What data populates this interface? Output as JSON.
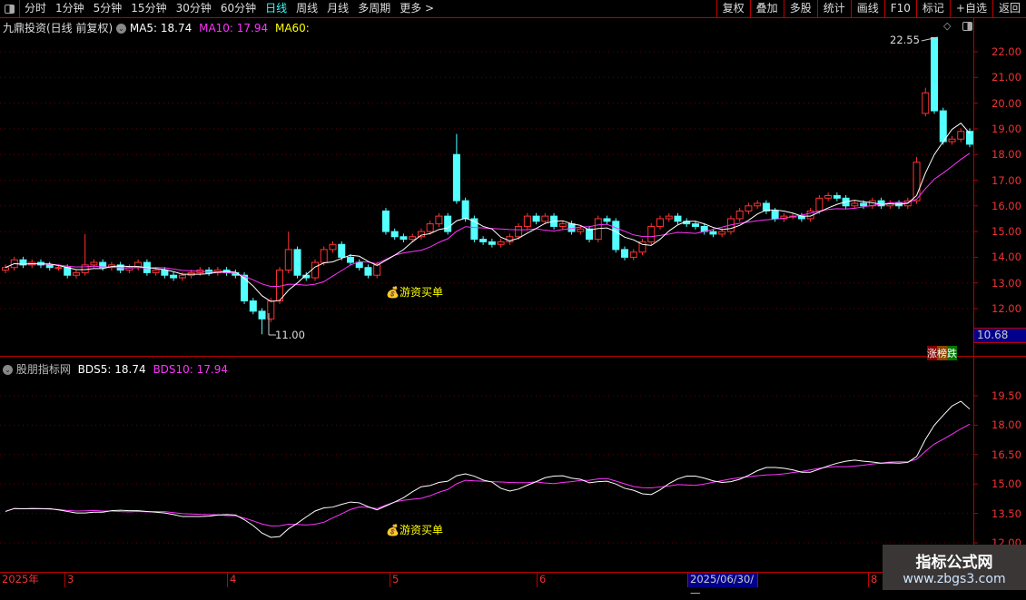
{
  "toolbar": {
    "periods": [
      "分时",
      "1分钟",
      "5分钟",
      "15分钟",
      "30分钟",
      "60分钟",
      "日线",
      "周线",
      "月线",
      "多周期",
      "更多 >"
    ],
    "active": "日线",
    "right": [
      "复权",
      "叠加",
      "多股",
      "统计",
      "画线",
      "F10",
      "标记",
      "+自选",
      "返回"
    ]
  },
  "main": {
    "title": "九鼎投资(日线 前复权)",
    "ma5": "MA5: 18.74",
    "ma10": "MA10: 17.94",
    "ma60": "MA60:",
    "high_label": "22.55",
    "low_label": "11.00",
    "signal": "游资买单",
    "current_price": "10.68",
    "badge": [
      "涨",
      "榜",
      "跌"
    ],
    "ticks": [
      "22.00",
      "21.00",
      "20.00",
      "19.00",
      "18.00",
      "17.00",
      "16.00",
      "15.00",
      "14.00",
      "13.00",
      "12.00"
    ]
  },
  "sub": {
    "title": "股朋指标网",
    "bds5": "BDS5: 18.74",
    "bds10": "BDS10: 17.94",
    "signal": "游资买单",
    "ticks": [
      "19.50",
      "18.00",
      "16.50",
      "15.00",
      "13.50",
      "12.00"
    ]
  },
  "dates": {
    "labels": [
      "2025年",
      "3",
      "4",
      "5",
      "6",
      "2025/06/30/—",
      "8"
    ]
  },
  "watermark": {
    "title": "指标公式网",
    "url": "www.zbgs3.com"
  },
  "colors": {
    "up": "#ff3333",
    "down": "#54ffff",
    "ma5": "#ffffff",
    "ma10": "#ff33ff",
    "ma60": "#ffff00"
  },
  "chart_data": {
    "type": "candlestick",
    "closes": [
      13.6,
      13.9,
      13.7,
      13.8,
      13.7,
      13.6,
      13.6,
      13.3,
      13.4,
      13.7,
      13.8,
      13.6,
      13.7,
      13.5,
      13.6,
      13.8,
      13.4,
      13.5,
      13.3,
      13.2,
      13.3,
      13.4,
      13.5,
      13.4,
      13.5,
      13.4,
      13.3,
      12.3,
      11.9,
      11.6,
      12.3,
      13.5,
      14.3,
      13.3,
      13.2,
      13.8,
      14.3,
      14.5,
      14.0,
      13.8,
      13.6,
      13.3,
      13.7,
      15.0,
      14.8,
      14.7,
      14.8,
      15.0,
      15.3,
      15.6,
      15.0,
      16.2,
      15.5,
      14.7,
      14.6,
      14.5,
      14.6,
      14.8,
      15.2,
      15.6,
      15.4,
      15.6,
      15.2,
      15.3,
      15.0,
      15.1,
      14.7,
      15.5,
      15.4,
      14.3,
      14.0,
      14.2,
      14.6,
      15.2,
      15.5,
      15.6,
      15.4,
      15.3,
      15.2,
      15.0,
      14.9,
      15.0,
      15.5,
      15.8,
      16.0,
      16.1,
      15.8,
      15.5,
      15.6,
      15.6,
      15.5,
      15.8,
      16.3,
      16.4,
      16.3,
      16.0,
      16.1,
      16.0,
      16.2,
      16.0,
      16.1,
      16.0,
      16.2,
      17.7,
      20.4,
      19.7,
      18.5,
      18.6,
      18.9,
      18.4
    ],
    "overrides": [
      {
        "i": 9,
        "h": 14.9
      },
      {
        "i": 29,
        "l": 11.0
      },
      {
        "i": 32,
        "h": 15.0
      },
      {
        "i": 43,
        "o": 15.8
      },
      {
        "i": 51,
        "o": 18.0,
        "h": 18.8
      },
      {
        "i": 104,
        "o": 19.6,
        "h": 20.6
      },
      {
        "i": 105,
        "o": 22.55,
        "h": 22.55
      },
      {
        "i": 103,
        "h": 17.9
      }
    ],
    "price_range": [
      10.6,
      22.7
    ]
  }
}
